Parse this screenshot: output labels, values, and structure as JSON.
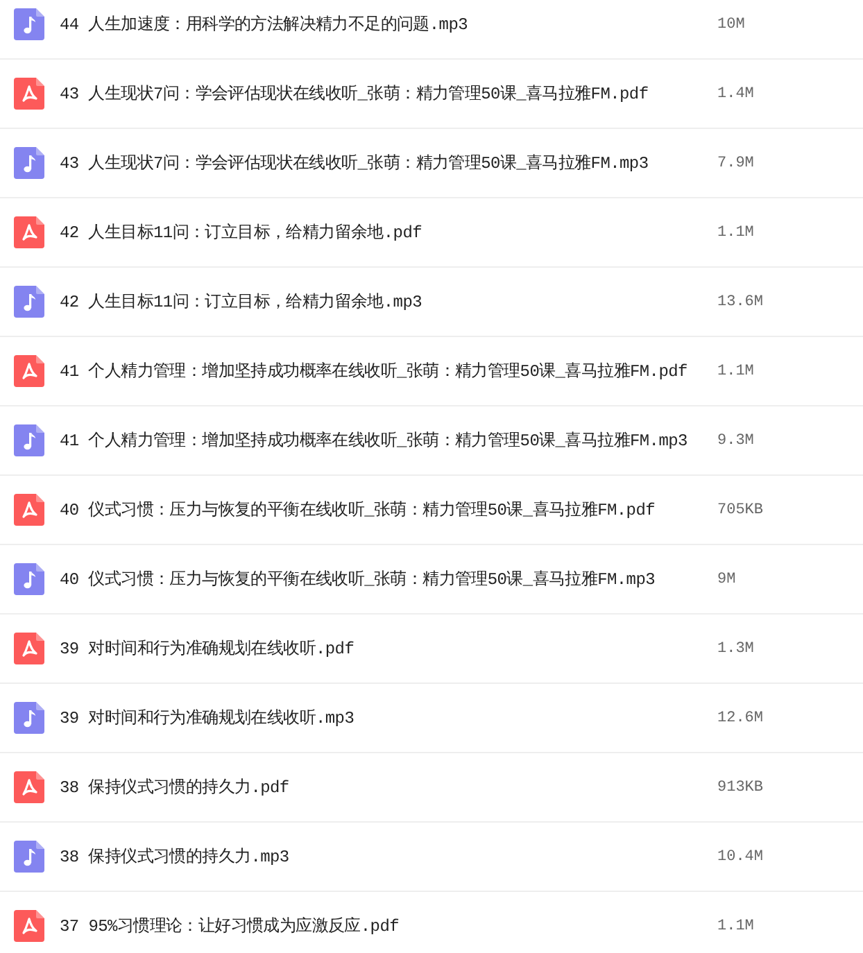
{
  "files": [
    {
      "kind": "audio",
      "name": "44 人生加速度：用科学的方法解决精力不足的问题.mp3",
      "size": "10M"
    },
    {
      "kind": "pdf",
      "name": "43 人生现状7问：学会评估现状在线收听_张萌：精力管理50课_喜马拉雅FM.pdf",
      "size": "1.4M"
    },
    {
      "kind": "audio",
      "name": "43 人生现状7问：学会评估现状在线收听_张萌：精力管理50课_喜马拉雅FM.mp3",
      "size": "7.9M"
    },
    {
      "kind": "pdf",
      "name": "42 人生目标11问：订立目标，给精力留余地.pdf",
      "size": "1.1M"
    },
    {
      "kind": "audio",
      "name": "42 人生目标11问：订立目标，给精力留余地.mp3",
      "size": "13.6M"
    },
    {
      "kind": "pdf",
      "name": "41 个人精力管理：增加坚持成功概率在线收听_张萌：精力管理50课_喜马拉雅FM.pdf",
      "size": "1.1M"
    },
    {
      "kind": "audio",
      "name": "41 个人精力管理：增加坚持成功概率在线收听_张萌：精力管理50课_喜马拉雅FM.mp3",
      "size": "9.3M"
    },
    {
      "kind": "pdf",
      "name": "40 仪式习惯：压力与恢复的平衡在线收听_张萌：精力管理50课_喜马拉雅FM.pdf",
      "size": "705KB"
    },
    {
      "kind": "audio",
      "name": "40 仪式习惯：压力与恢复的平衡在线收听_张萌：精力管理50课_喜马拉雅FM.mp3",
      "size": "9M"
    },
    {
      "kind": "pdf",
      "name": "39 对时间和行为准确规划在线收听.pdf",
      "size": "1.3M"
    },
    {
      "kind": "audio",
      "name": "39 对时间和行为准确规划在线收听.mp3",
      "size": "12.6M"
    },
    {
      "kind": "pdf",
      "name": "38 保持仪式习惯的持久力.pdf",
      "size": "913KB"
    },
    {
      "kind": "audio",
      "name": "38 保持仪式习惯的持久力.mp3",
      "size": "10.4M"
    },
    {
      "kind": "pdf",
      "name": "37 95%习惯理论：让好习惯成为应激反应.pdf",
      "size": "1.1M"
    }
  ]
}
